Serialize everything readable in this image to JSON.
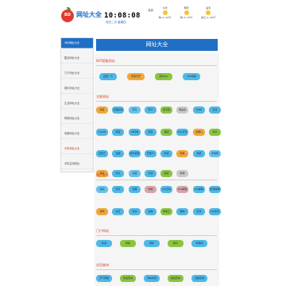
{
  "header": {
    "logo_text": "BD",
    "brand": "网址大全",
    "clock": "10:08:08",
    "date": "农历二月 星期四",
    "weather_label": "北京",
    "weather": [
      {
        "line1": "今天",
        "line2": "晴 2~14℃"
      },
      {
        "line1": "明天",
        "line2": "晴 3~15℃"
      },
      {
        "line1": "后天",
        "line2": "多云 4~16℃"
      }
    ]
  },
  "sidebar": {
    "items": [
      {
        "label": "360网址大全"
      },
      {
        "label": "酷站网址大全"
      },
      {
        "label": "门户网址大全"
      },
      {
        "label": "娱乐网址大全"
      },
      {
        "label": "生活网址大全"
      },
      {
        "label": "购物网址大全"
      },
      {
        "label": "电脑网址大全"
      },
      {
        "label": "手机网址大全"
      },
      {
        "label": "手机应用网址"
      }
    ]
  },
  "main": {
    "title": "网址大全",
    "sections": [
      {
        "heading": "BAT超级网站",
        "links": [
          "百度一下",
          "阿里巴巴",
          "腾讯QQ",
          "360导航"
        ]
      },
      {
        "heading": "主推网站",
        "links": [
          "淘宝",
          "天猫商城",
          "京东",
          "苏宁",
          "亚马逊",
          "唯品会",
          "1688",
          "当当",
          "12306",
          "携程",
          "58同城",
          "赶集",
          "美团",
          "大众点评",
          "去哪儿",
          "途牛",
          "爱奇艺",
          "优酷",
          "腾讯视频",
          "芒果TV",
          "新浪",
          "网易",
          "搜狐",
          "凤凰网",
          "百度",
          "知乎",
          "豆瓣",
          "天涯",
          "贴吧",
          "微博"
        ]
      },
      {
        "heading": "热门平台",
        "links": [
          "贴吧",
          "知乎",
          "豆瓣",
          "微信",
          "QQ空间",
          "163邮箱",
          "QQ邮箱",
          "新浪微博",
          "搜狗",
          "必应",
          "有道",
          "谷歌",
          "网易云",
          "酷狗",
          "虾米",
          "QQ音乐"
        ]
      },
      {
        "heading": "门户网站",
        "links": [
          "新浪",
          "搜狐",
          "网易",
          "腾讯",
          "凤凰网"
        ]
      },
      {
        "heading": "实用查询",
        "links": [
          "天气预报",
          "快递查询",
          "列车时刻",
          "航班查询",
          "违章查询"
        ]
      }
    ]
  }
}
